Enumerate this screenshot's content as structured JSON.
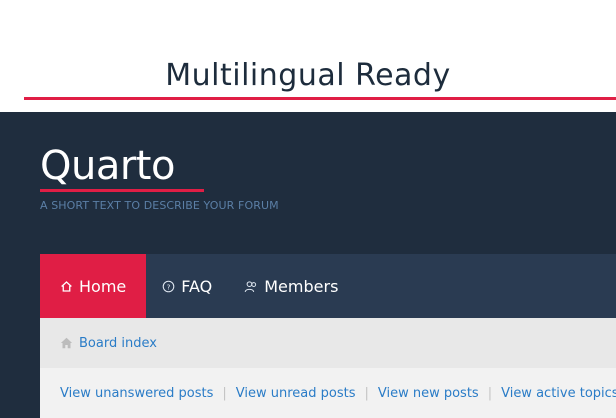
{
  "promo": {
    "title": "Multilingual Ready"
  },
  "site": {
    "name": "Quarto",
    "tagline": "A SHORT TEXT TO DESCRIBE YOUR FORUM"
  },
  "nav": {
    "items": [
      {
        "label": "Home",
        "icon": "home-icon",
        "active": true
      },
      {
        "label": "FAQ",
        "icon": "question-circle-icon",
        "active": false
      },
      {
        "label": "Members",
        "icon": "users-icon",
        "active": false
      }
    ]
  },
  "breadcrumb": {
    "icon": "home-icon",
    "label": "Board index"
  },
  "quick_links": [
    "View unanswered posts",
    "View unread posts",
    "View new posts",
    "View active topics"
  ],
  "separator": "|",
  "colors": {
    "accent": "#e01e45",
    "header_bg": "#1f2d3e",
    "nav_bg": "#2a3b52",
    "link": "#2a7cc7"
  }
}
